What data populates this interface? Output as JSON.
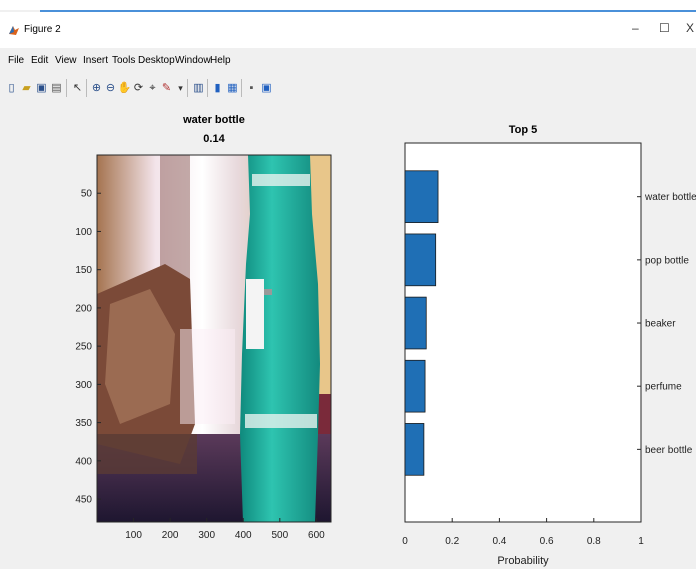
{
  "window": {
    "title": "Figure 2",
    "minimize_glyph": "–",
    "maximize_glyph": "☐",
    "close_glyph": "X"
  },
  "menu": [
    "File",
    "Edit",
    "View",
    "Insert",
    "Tools",
    "Desktop",
    "Window",
    "Help"
  ],
  "toolbar_icons": [
    "new-figure-icon",
    "open-file-icon",
    "save-icon",
    "print-icon",
    "pointer-icon",
    "zoom-in-icon",
    "zoom-out-icon",
    "pan-icon",
    "rotate-3d-icon",
    "data-cursor-icon",
    "brush-icon",
    "link-icon",
    "insert-colorbar-icon",
    "insert-legend-icon",
    "hide-plot-tools-icon",
    "show-plot-tools-icon"
  ],
  "image_plot": {
    "title_line1": "water bottle",
    "title_line2": "0.14",
    "x_ticks": [
      "100",
      "200",
      "300",
      "400",
      "500",
      "600"
    ],
    "y_ticks": [
      "50",
      "100",
      "150",
      "200",
      "250",
      "300",
      "350",
      "400",
      "450"
    ]
  },
  "chart_data": {
    "type": "bar",
    "orientation": "horizontal",
    "title": "Top 5",
    "xlabel": "Probability",
    "ylabel": "",
    "xlim": [
      0,
      1
    ],
    "x_ticks": [
      "0",
      "0.2",
      "0.4",
      "0.6",
      "0.8",
      "1"
    ],
    "categories": [
      "water bottle",
      "pop bottle",
      "beaker",
      "perfume",
      "beer bottle"
    ],
    "values": [
      0.14,
      0.13,
      0.09,
      0.085,
      0.08
    ],
    "bar_color": "#1f6fb5"
  }
}
